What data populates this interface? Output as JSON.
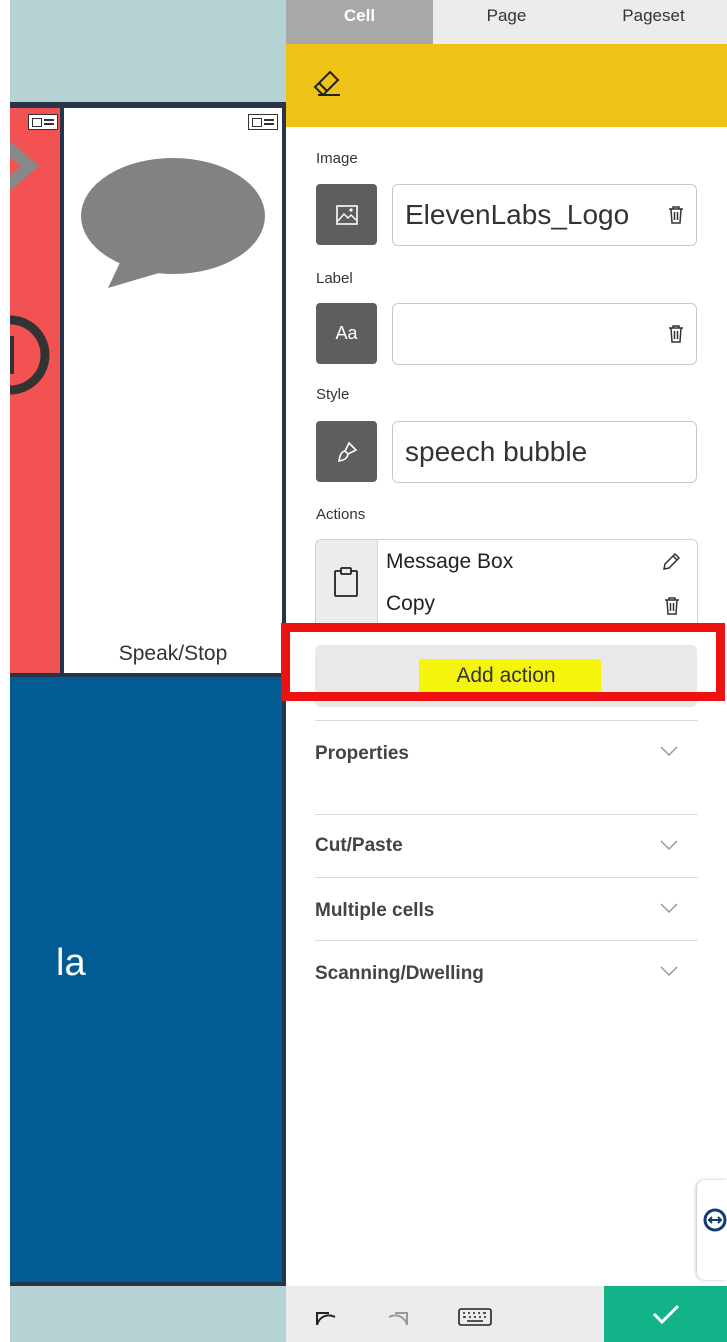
{
  "tabs": [
    {
      "label": "Cell",
      "active": true
    },
    {
      "label": "Page",
      "active": false
    },
    {
      "label": "Pageset",
      "active": false
    }
  ],
  "grid": {
    "speech_cell_label": "Speak/Stop",
    "blue_cell_label": "la",
    "colors": {
      "red_cell": "#f25252",
      "blue_cell": "#035b94",
      "speech_bubble": "#828282",
      "frame": "#273449"
    }
  },
  "panel": {
    "header_color": "#eec216",
    "header_icon": "eraser-icon",
    "image": {
      "label": "Image",
      "value": "ElevenLabs_Logo",
      "icon": "image-icon"
    },
    "text_label": {
      "label": "Label",
      "value": "",
      "icon": "text-aa-icon",
      "icon_text": "Aa"
    },
    "style": {
      "label": "Style",
      "value": "speech bubble",
      "icon": "brush-icon"
    },
    "actions": {
      "label": "Actions",
      "icon": "clipboard-icon",
      "items": [
        {
          "text": "Message Box",
          "control": "pencil-icon"
        },
        {
          "text": "Copy",
          "control": "trash-icon"
        }
      ]
    },
    "add_action_label": "Add action",
    "sections": [
      {
        "label": "Properties"
      },
      {
        "label": "Cut/Paste"
      },
      {
        "label": "Multiple cells"
      },
      {
        "label": "Scanning/Dwelling"
      }
    ]
  },
  "toolbar": {
    "icons": [
      "undo-icon",
      "redo-icon",
      "keyboard-icon"
    ],
    "confirm_icon": "checkmark-icon",
    "confirm_color": "#13b38a"
  },
  "annotation": {
    "frame_color": "#ee1111",
    "highlight_color": "#f4f40d"
  }
}
